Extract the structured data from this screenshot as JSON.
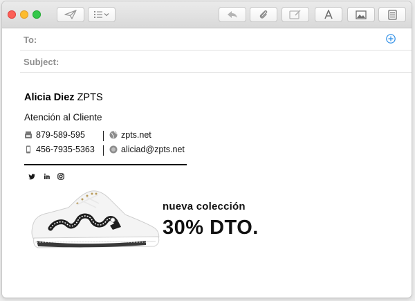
{
  "window": {
    "controls": [
      "close",
      "minimize",
      "zoom"
    ],
    "toolbar_icons": [
      "send-icon",
      "list-format-icon",
      "reply-icon",
      "attachment-icon",
      "markup-icon",
      "font-icon",
      "photo-browser-icon",
      "stationery-icon"
    ]
  },
  "header": {
    "to_label": "To:",
    "subject_label": "Subject:"
  },
  "signature": {
    "name": "Alicia Diez",
    "company": "ZPTS",
    "role": "Atención al Cliente",
    "phone": "879-589-595",
    "website": "zpts.net",
    "mobile": "456-7935-5363",
    "email": "aliciad@zpts.net",
    "social": [
      "twitter-icon",
      "linkedin-icon",
      "instagram-icon"
    ]
  },
  "promo": {
    "line1": "nueva colección",
    "line2": "30% DTO."
  },
  "colors": {
    "accent": "#2a8ce6",
    "close": "#fc5f57",
    "minimize": "#fdbc2e",
    "zoom": "#34c84a"
  }
}
